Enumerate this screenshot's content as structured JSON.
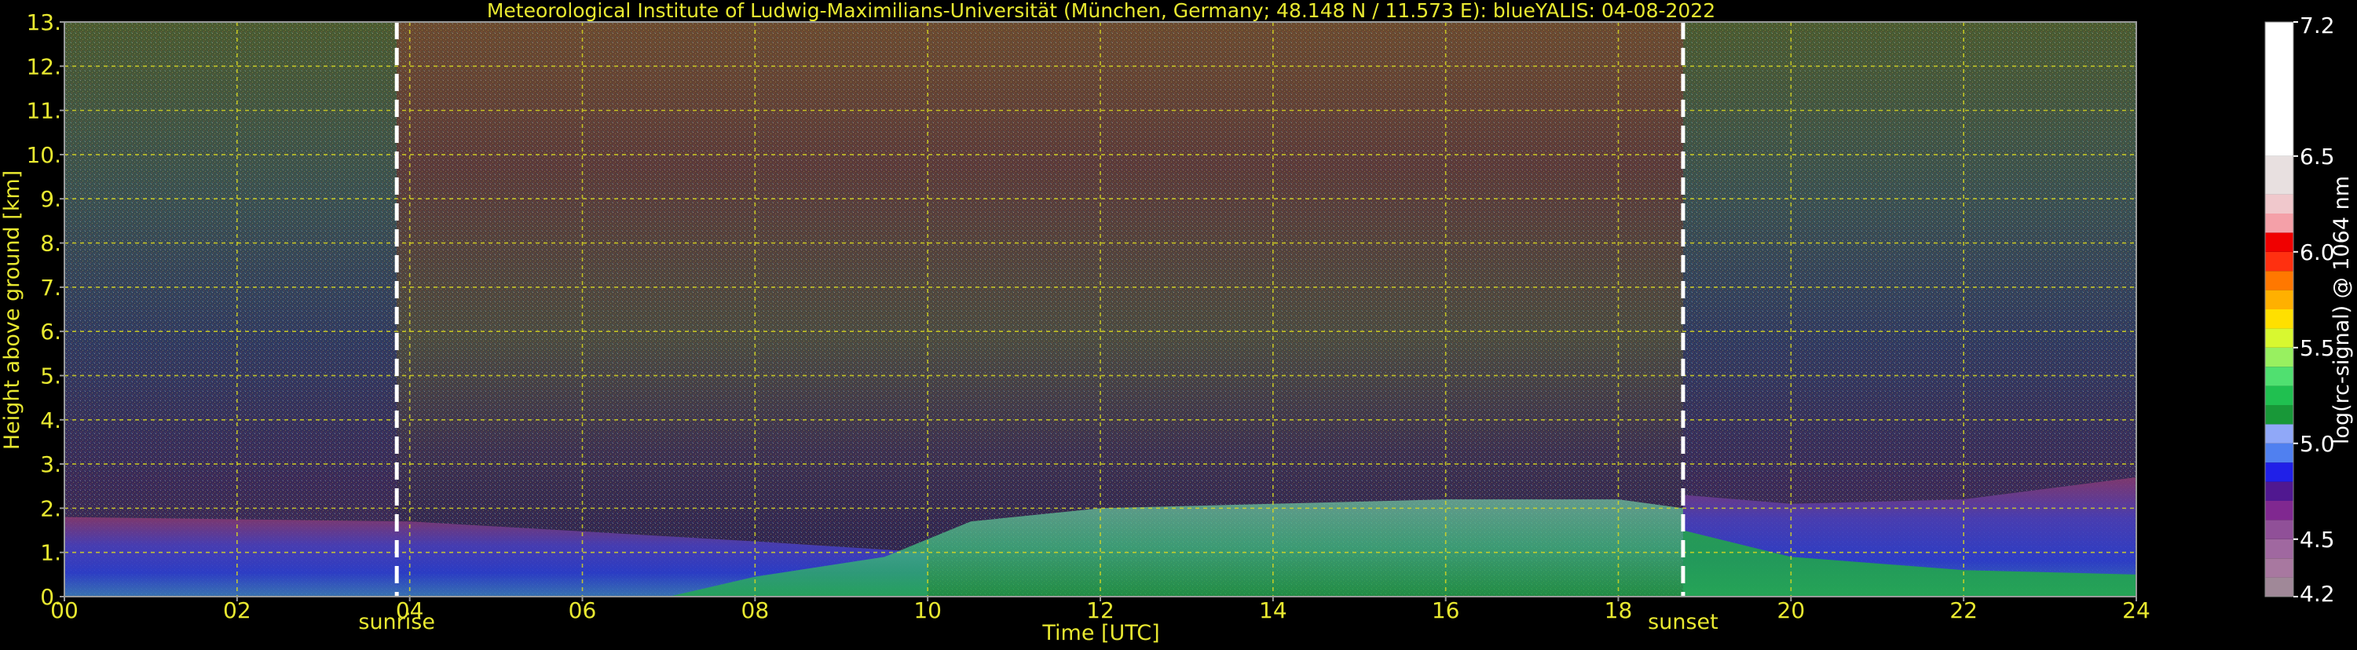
{
  "chart_data": {
    "type": "heatmap",
    "title": "Meteorological Institute of Ludwig-Maximilians-Universität (München, Germany; 48.148 N / 11.573 E):    blueYALIS: 04-08-2022",
    "xlabel": "Time [UTC]",
    "ylabel": "Height above ground [km]",
    "x_ticks": [
      "00",
      "02",
      "04",
      "06",
      "08",
      "10",
      "12",
      "14",
      "16",
      "18",
      "20",
      "22",
      "24"
    ],
    "y_ticks": [
      "0.",
      "1.",
      "2.",
      "3.",
      "4.",
      "5.",
      "6.",
      "7.",
      "8.",
      "9.",
      "10.",
      "11.",
      "12.",
      "13."
    ],
    "xlim": [
      0,
      24
    ],
    "ylim": [
      0,
      13
    ],
    "grid": true,
    "annotations": [
      {
        "label": "sunrise",
        "x": 3.85
      },
      {
        "label": "sunset",
        "x": 18.75
      }
    ],
    "colorbar": {
      "label": "log(rc-signal) @ 1064 nm",
      "range": [
        4.2,
        7.2
      ],
      "ticks": [
        "4.2",
        "4.5",
        "5.0",
        "5.5",
        "6.0",
        "6.5",
        "7.2"
      ],
      "segments": [
        {
          "from": 4.2,
          "to": 4.3,
          "color": "#a08898"
        },
        {
          "from": 4.3,
          "to": 4.4,
          "color": "#a878a0"
        },
        {
          "from": 4.4,
          "to": 4.5,
          "color": "#a068a0"
        },
        {
          "from": 4.5,
          "to": 4.6,
          "color": "#905098"
        },
        {
          "from": 4.6,
          "to": 4.7,
          "color": "#802890"
        },
        {
          "from": 4.7,
          "to": 4.8,
          "color": "#501890"
        },
        {
          "from": 4.8,
          "to": 4.9,
          "color": "#2020e8"
        },
        {
          "from": 4.9,
          "to": 5.0,
          "color": "#5080f0"
        },
        {
          "from": 5.0,
          "to": 5.1,
          "color": "#90a8f8"
        },
        {
          "from": 5.1,
          "to": 5.2,
          "color": "#189838"
        },
        {
          "from": 5.2,
          "to": 5.3,
          "color": "#20c050"
        },
        {
          "from": 5.3,
          "to": 5.4,
          "color": "#50e070"
        },
        {
          "from": 5.4,
          "to": 5.5,
          "color": "#98f060"
        },
        {
          "from": 5.5,
          "to": 5.6,
          "color": "#d8f830"
        },
        {
          "from": 5.6,
          "to": 5.7,
          "color": "#ffe000"
        },
        {
          "from": 5.7,
          "to": 5.8,
          "color": "#ffb000"
        },
        {
          "from": 5.8,
          "to": 5.9,
          "color": "#ff7800"
        },
        {
          "from": 5.9,
          "to": 6.0,
          "color": "#ff3010"
        },
        {
          "from": 6.0,
          "to": 6.1,
          "color": "#f00000"
        },
        {
          "from": 6.1,
          "to": 6.2,
          "color": "#f4a0a8"
        },
        {
          "from": 6.2,
          "to": 6.3,
          "color": "#f0c8cc"
        },
        {
          "from": 6.3,
          "to": 6.5,
          "color": "#e8e0e0"
        },
        {
          "from": 6.5,
          "to": 7.2,
          "color": "#ffffff"
        }
      ]
    },
    "colors": {
      "text": "#e8e830",
      "grid": "#d8d820",
      "background": "#000000",
      "marker_line": "#ffffff"
    }
  }
}
